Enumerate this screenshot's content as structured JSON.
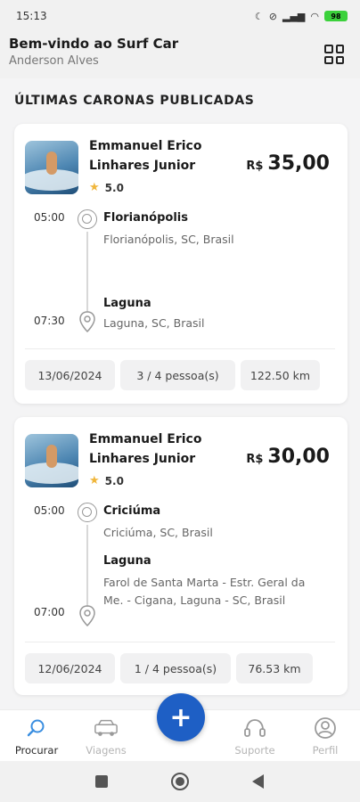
{
  "status_bar": {
    "time": "15:13",
    "battery": "98",
    "signal": "4G"
  },
  "header": {
    "title": "Bem-vindo ao Surf Car",
    "subtitle": "Anderson Alves",
    "menu_icon": "grid-icon"
  },
  "section": {
    "title": "ÚLTIMAS CARONAS PUBLICADAS"
  },
  "rides": [
    {
      "driver": "Emmanuel Erico Linhares Junior",
      "rating": "5.0",
      "currency": "R$",
      "price": "35,00",
      "origin": {
        "time": "05:00",
        "city": "Florianópolis",
        "address": "Florianópolis, SC, Brasil"
      },
      "destination": {
        "time": "07:30",
        "city": "Laguna",
        "address": "Laguna, SC, Brasil"
      },
      "date": "13/06/2024",
      "seats": "3 / 4 pessoa(s)",
      "distance": "122.50 km"
    },
    {
      "driver": "Emmanuel Erico Linhares Junior",
      "rating": "5.0",
      "currency": "R$",
      "price": "30,00",
      "origin": {
        "time": "05:00",
        "city": "Criciúma",
        "address": "Criciúma, SC, Brasil"
      },
      "destination": {
        "time": "07:00",
        "city": "Laguna",
        "address": "Farol de Santa Marta - Estr. Geral da Me. - Cigana, Laguna - SC, Brasil"
      },
      "date": "12/06/2024",
      "seats": "1 / 4 pessoa(s)",
      "distance": "76.53 km"
    }
  ],
  "bottom_nav": {
    "items": [
      {
        "label": "Procurar",
        "icon": "search-icon",
        "active": true
      },
      {
        "label": "Viagens",
        "icon": "car-icon",
        "active": false
      },
      {
        "label": "Suporte",
        "icon": "headset-icon",
        "active": false
      },
      {
        "label": "Perfil",
        "icon": "user-icon",
        "active": false
      }
    ],
    "fab_label": "+",
    "accent": "#1e5fc5"
  }
}
